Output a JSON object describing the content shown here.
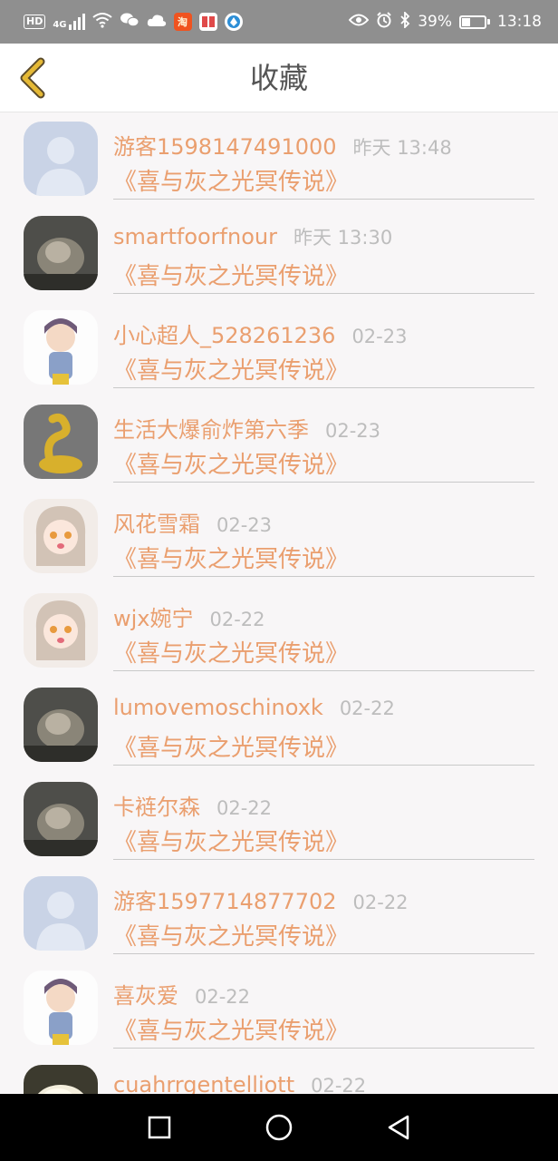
{
  "status_bar": {
    "hd": "HD",
    "network": "4G",
    "shop_icon_text": "淘",
    "battery_percent": "39%",
    "time": "13:18",
    "battery_level": 0.39
  },
  "header": {
    "title": "收藏"
  },
  "colors": {
    "accent": "#ea9f6f",
    "back_arrow": "#e5b936",
    "time_text": "#bdbdbd",
    "status_bar_bg": "#8f8f8f"
  },
  "items": [
    {
      "name": "游客1598147491000",
      "time": "昨天 13:48",
      "book": "《喜与灰之光冥传说》",
      "avatar": "default-avatar"
    },
    {
      "name": "smartfoorfnour",
      "time": "昨天 13:30",
      "book": "《喜与灰之光冥传说》",
      "avatar": "user-photo"
    },
    {
      "name": "小心超人_528261236",
      "time": "02-23",
      "book": "《喜与灰之光冥传说》",
      "avatar": "anime-avatar"
    },
    {
      "name": "生活大爆俞炸第六季",
      "time": "02-23",
      "book": "《喜与灰之光冥传说》",
      "avatar": "snake-figure-avatar"
    },
    {
      "name": "风花雪霜",
      "time": "02-23",
      "book": "《喜与灰之光冥传说》",
      "avatar": "anime-girl-avatar"
    },
    {
      "name": "wjx婉宁",
      "time": "02-22",
      "book": "《喜与灰之光冥传说》",
      "avatar": "anime-girl-avatar"
    },
    {
      "name": "lumovemoschinoxk",
      "time": "02-22",
      "book": "《喜与灰之光冥传说》",
      "avatar": "user-photo"
    },
    {
      "name": "卡裢尔森",
      "time": "02-22",
      "book": "《喜与灰之光冥传说》",
      "avatar": "user-photo"
    },
    {
      "name": "游客1597714877702",
      "time": "02-22",
      "book": "《喜与灰之光冥传说》",
      "avatar": "default-avatar"
    },
    {
      "name": "喜灰爱",
      "time": "02-22",
      "book": "《喜与灰之光冥传说》",
      "avatar": "anime-avatar"
    },
    {
      "name": "cuahrrgentelliott",
      "time": "02-22",
      "book": "",
      "avatar": "food-photo-avatar"
    }
  ],
  "nav": {
    "icons": [
      "square-icon",
      "circle-icon",
      "triangle-back-icon"
    ]
  }
}
